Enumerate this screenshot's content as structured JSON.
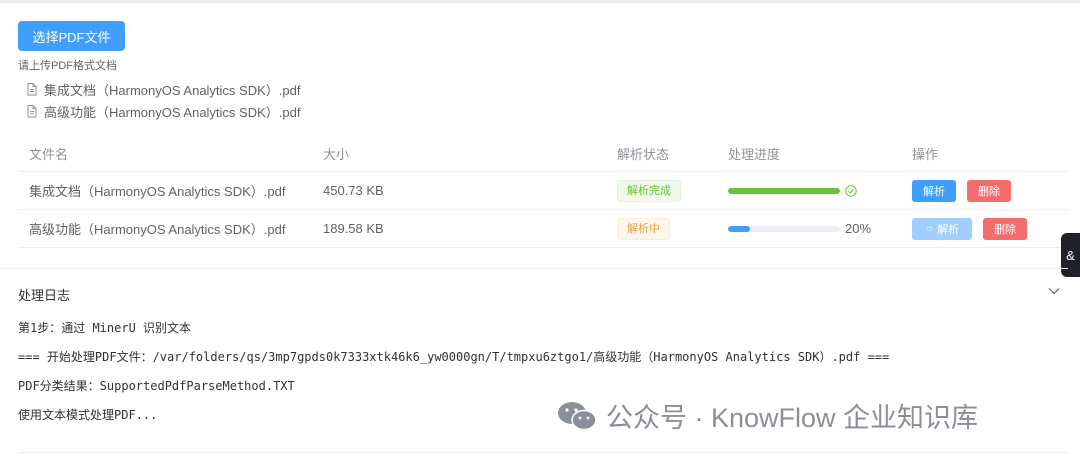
{
  "upload": {
    "button_label": "选择PDF文件",
    "tip": "请上传PDF格式文档",
    "files": [
      "集成文档（HarmonyOS Analytics SDK）.pdf",
      "高级功能（HarmonyOS Analytics SDK）.pdf"
    ]
  },
  "table": {
    "headers": {
      "name": "文件名",
      "size": "大小",
      "status": "解析状态",
      "progress": "处理进度",
      "actions": "操作"
    },
    "rows": [
      {
        "name": "集成文档（HarmonyOS Analytics SDK）.pdf",
        "size": "450.73 KB",
        "status": "解析完成",
        "progress_percent": 100,
        "parse_label": "解析",
        "delete_label": "删除"
      },
      {
        "name": "高级功能（HarmonyOS Analytics SDK）.pdf",
        "size": "189.58 KB",
        "status": "解析中",
        "progress_percent": 20,
        "progress_text": "20%",
        "parse_label": "解析",
        "delete_label": "删除"
      }
    ]
  },
  "side_tab": {
    "label": "&"
  },
  "log": {
    "title": "处理日志",
    "lines": [
      "第1步：通过 MinerU 识别文本",
      "=== 开始处理PDF文件：/var/folders/qs/3mp7gpds0k7333xtk46k6_yw0000gn/T/tmpxu6ztgo1/高级功能（HarmonyOS Analytics SDK）.pdf ===",
      "PDF分类结果：SupportedPdfParseMethod.TXT",
      "使用文本模式处理PDF..."
    ]
  },
  "watermark": {
    "text": "公众号 · KnowFlow 企业知识库"
  },
  "colors": {
    "primary": "#409eff",
    "success": "#67c23a",
    "warning": "#e6a23c",
    "danger": "#f56c6c"
  }
}
